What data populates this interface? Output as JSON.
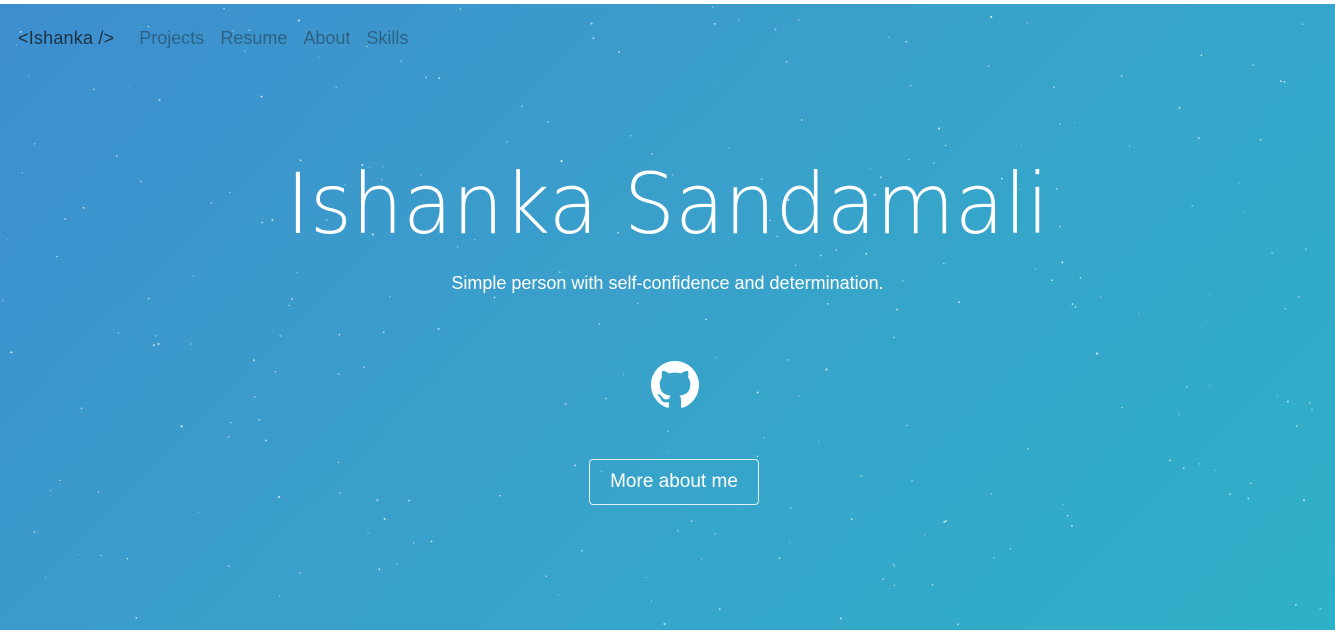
{
  "nav": {
    "brand": "<Ishanka />",
    "links": [
      "Projects",
      "Resume",
      "About",
      "Skills"
    ]
  },
  "hero": {
    "title": "Ishanka Sandamali",
    "tagline": "Simple person with self-confidence and determination.",
    "social_icon": "github-icon",
    "cta_label": "More about me"
  },
  "colors": {
    "gradient_start": "#3d8ecf",
    "gradient_end": "#2eb0c8",
    "text": "#ffffff",
    "brand_text": "#1e3140",
    "nav_text": "#2b5a78"
  }
}
